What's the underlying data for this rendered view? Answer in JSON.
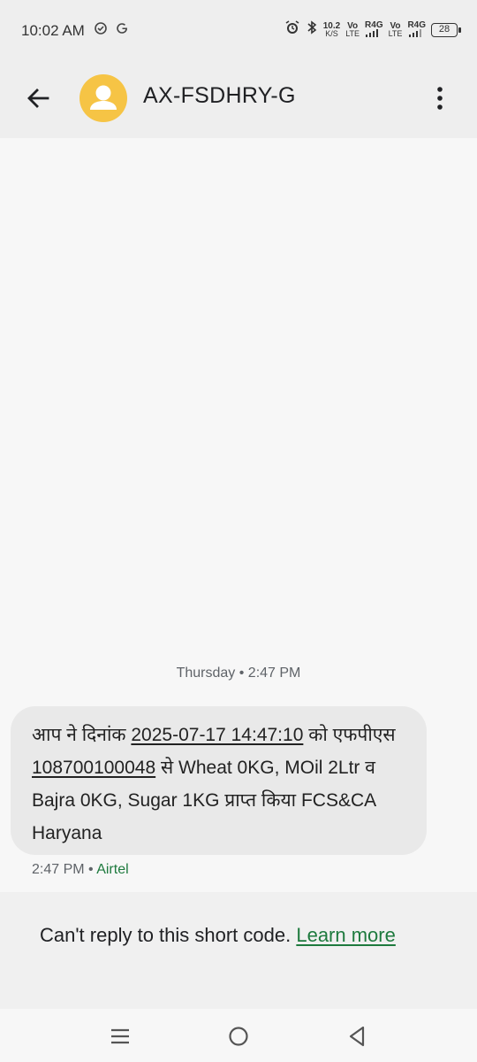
{
  "status_bar": {
    "time": "10:02 AM",
    "speed_value": "10.2",
    "speed_unit": "K/S",
    "sim1_vo": "Vo",
    "sim1_lte": "LTE",
    "sim1_net": "R4G",
    "sim2_vo": "Vo",
    "sim2_lte": "LTE",
    "sim2_net": "R4G",
    "battery": "28"
  },
  "header": {
    "title": "AX-FSDHRY-G"
  },
  "thread": {
    "date_separator": "Thursday • 2:47 PM",
    "message": {
      "part1": "आप ने दिनांक ",
      "date_link": "2025-07-17 14:47:10",
      "part2": " को एफपीएस ",
      "number_link": "108700100048",
      "part3": "  से Wheat 0KG, MOil 2Ltr व Bajra 0KG, Sugar 1KG प्राप्त किया FCS&CA Haryana"
    },
    "meta_time": "2:47 PM",
    "meta_sep": " • ",
    "meta_carrier": "Airtel"
  },
  "reply": {
    "notice": "Can't reply to this short code. ",
    "learn_more": "Learn more"
  },
  "colors": {
    "accent_green": "#1e7a3e",
    "avatar_yellow": "#f6c445"
  }
}
